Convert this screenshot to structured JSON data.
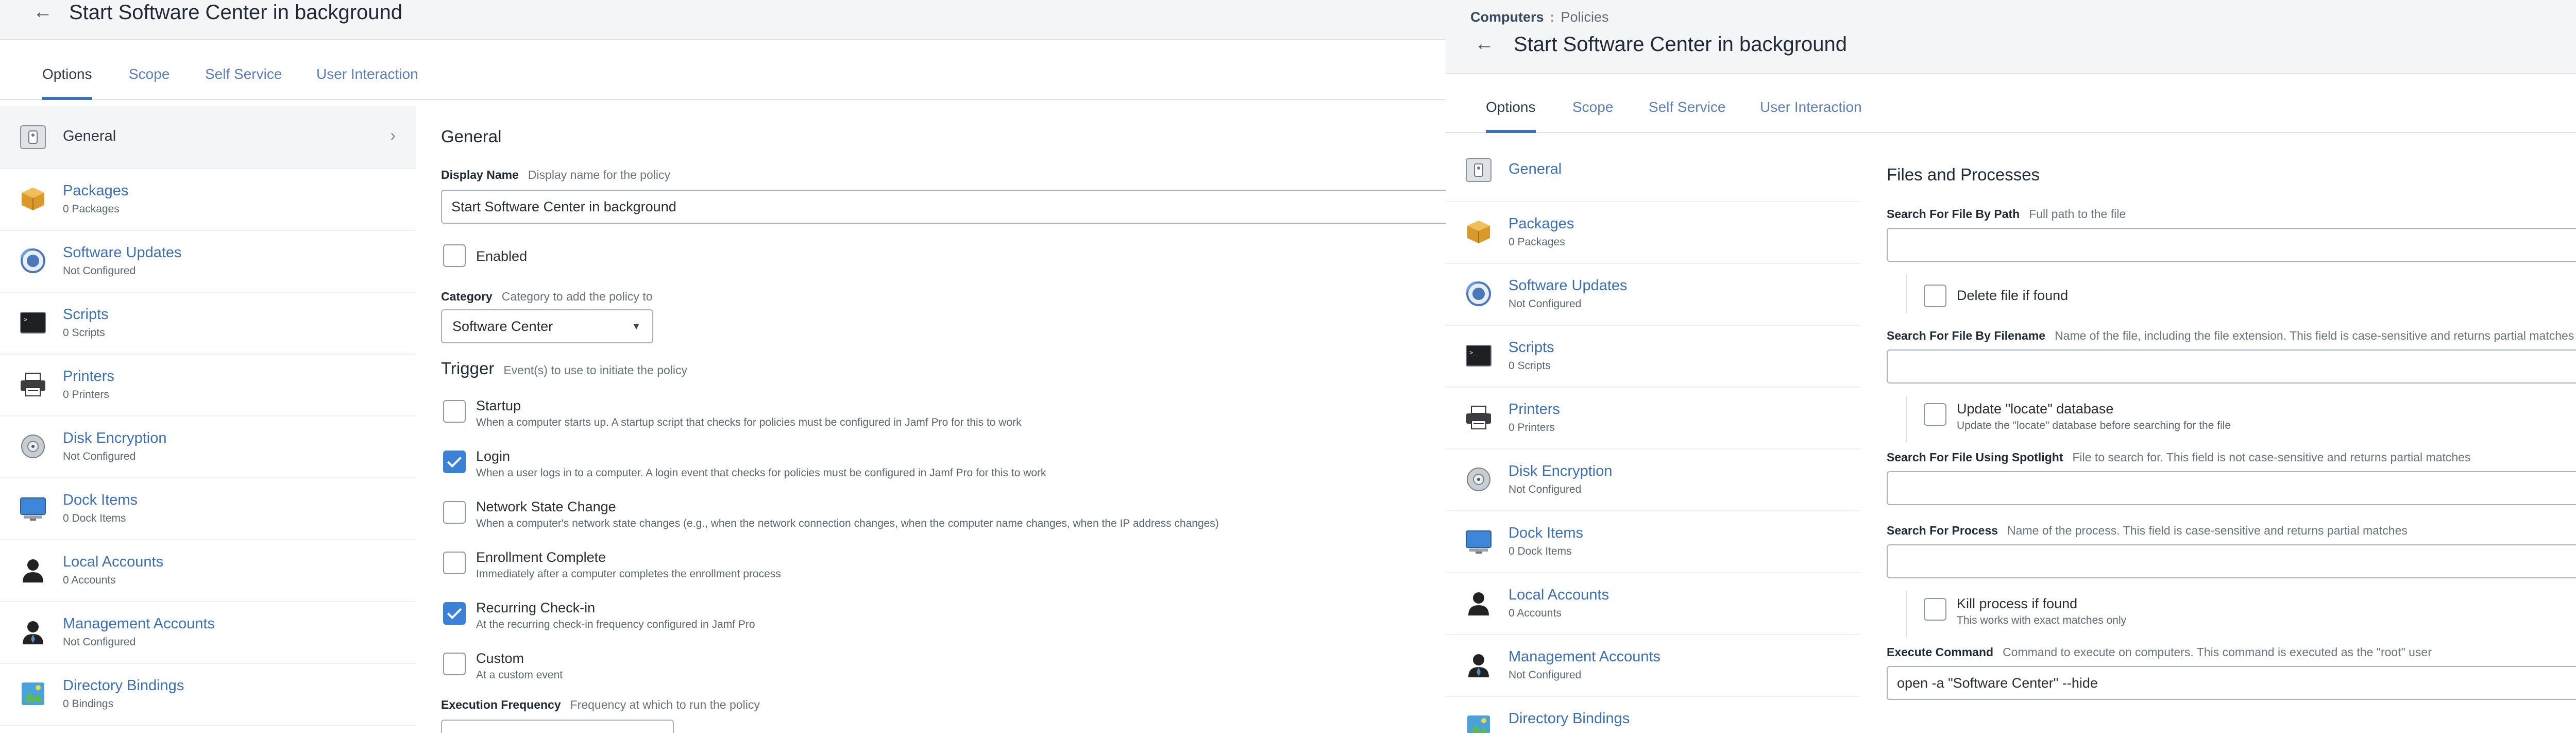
{
  "left": {
    "title": "Start Software Center in background",
    "tabs": [
      "Options",
      "Scope",
      "Self Service",
      "User Interaction"
    ],
    "sidebar": [
      {
        "name": "General",
        "sub": "",
        "icon": "general-icon"
      },
      {
        "name": "Packages",
        "sub": "0 Packages",
        "icon": "packages-icon"
      },
      {
        "name": "Software Updates",
        "sub": "Not Configured",
        "icon": "software-updates-icon"
      },
      {
        "name": "Scripts",
        "sub": "0 Scripts",
        "icon": "scripts-icon"
      },
      {
        "name": "Printers",
        "sub": "0 Printers",
        "icon": "printers-icon"
      },
      {
        "name": "Disk Encryption",
        "sub": "Not Configured",
        "icon": "disk-encryption-icon"
      },
      {
        "name": "Dock Items",
        "sub": "0 Dock Items",
        "icon": "dock-items-icon"
      },
      {
        "name": "Local Accounts",
        "sub": "0 Accounts",
        "icon": "local-accounts-icon"
      },
      {
        "name": "Management Accounts",
        "sub": "Not Configured",
        "icon": "management-accounts-icon"
      },
      {
        "name": "Directory Bindings",
        "sub": "0 Bindings",
        "icon": "directory-bindings-icon"
      }
    ],
    "general": {
      "heading": "General",
      "display_name_label": "Display Name",
      "display_name_hint": "Display name for the policy",
      "display_name_value": "Start Software Center in background",
      "enabled_label": "Enabled",
      "category_label": "Category",
      "category_hint": "Category to add the policy to",
      "category_value": "Software Center",
      "trigger_label": "Trigger",
      "trigger_hint": "Event(s) to use to initiate the policy",
      "triggers": [
        {
          "label": "Startup",
          "desc": "When a computer starts up. A startup script that checks for policies must be configured in Jamf Pro for this to work",
          "checked": false
        },
        {
          "label": "Login",
          "desc": "When a user logs in to a computer. A login event that checks for policies must be configured in Jamf Pro for this to work",
          "checked": true
        },
        {
          "label": "Network State Change",
          "desc": "When a computer's network state changes (e.g., when the network connection changes, when the computer name changes, when the IP address changes)",
          "checked": false
        },
        {
          "label": "Enrollment Complete",
          "desc": "Immediately after a computer completes the enrollment process",
          "checked": false
        },
        {
          "label": "Recurring Check-in",
          "desc": "At the recurring check-in frequency configured in Jamf Pro",
          "checked": true
        },
        {
          "label": "Custom",
          "desc": "At a custom event",
          "checked": false
        }
      ],
      "exec_freq_label": "Execution Frequency",
      "exec_freq_hint": "Frequency at which to run the policy"
    }
  },
  "right": {
    "breadcrumb": {
      "parent": "Computers",
      "separator": ":",
      "current": "Policies"
    },
    "title": "Start Software Center in background",
    "tabs": [
      "Options",
      "Scope",
      "Self Service",
      "User Interaction"
    ],
    "sidebar": [
      {
        "name": "General",
        "sub": "",
        "icon": "general-icon"
      },
      {
        "name": "Packages",
        "sub": "0 Packages",
        "icon": "packages-icon"
      },
      {
        "name": "Software Updates",
        "sub": "Not Configured",
        "icon": "software-updates-icon"
      },
      {
        "name": "Scripts",
        "sub": "0 Scripts",
        "icon": "scripts-icon"
      },
      {
        "name": "Printers",
        "sub": "0 Printers",
        "icon": "printers-icon"
      },
      {
        "name": "Disk Encryption",
        "sub": "Not Configured",
        "icon": "disk-encryption-icon"
      },
      {
        "name": "Dock Items",
        "sub": "0 Dock Items",
        "icon": "dock-items-icon"
      },
      {
        "name": "Local Accounts",
        "sub": "0 Accounts",
        "icon": "local-accounts-icon"
      },
      {
        "name": "Management Accounts",
        "sub": "Not Configured",
        "icon": "management-accounts-icon"
      },
      {
        "name": "Directory Bindings",
        "sub": "",
        "icon": "directory-bindings-icon"
      }
    ],
    "files": {
      "heading": "Files and Processes",
      "path_label": "Search For File By Path",
      "path_hint": "Full path to the file",
      "path_value": "",
      "delete_label": "Delete file if found",
      "filename_label": "Search For File By Filename",
      "filename_hint": "Name of the file, including the file extension. This field is case-sensitive and returns partial matches",
      "filename_value": "",
      "locate_label": "Update \"locate\" database",
      "locate_desc": "Update the \"locate\" database before searching for the file",
      "spotlight_label": "Search For File Using Spotlight",
      "spotlight_hint": "File to search for. This field is not case-sensitive and returns partial matches",
      "spotlight_value": "",
      "process_label": "Search For Process",
      "process_hint": "Name of the process. This field is case-sensitive and returns partial matches",
      "process_value": "",
      "kill_label": "Kill process if found",
      "kill_desc": "This works with exact matches only",
      "exec_label": "Execute Command",
      "exec_hint": "Command to execute on computers. This command is executed as the \"root\" user",
      "exec_value": "open -a \"Software Center\" --hide"
    }
  },
  "colors": {
    "accent": "#3b82d6",
    "link": "#3c6fb1",
    "header_bg": "#f3f5f7"
  }
}
